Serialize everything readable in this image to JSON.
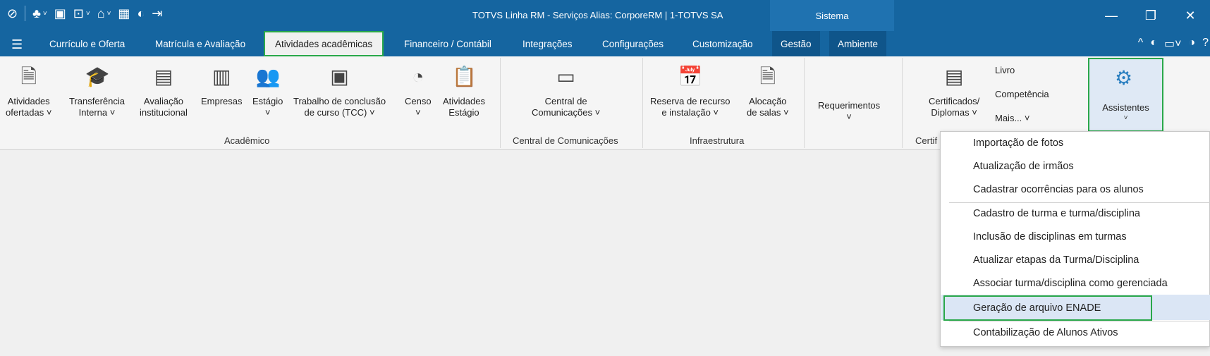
{
  "window": {
    "title": "TOTVS Linha RM - Serviços  Alias: CorporeRM | 1-TOTVS SA",
    "sistema_label": "Sistema",
    "controls": [
      "—",
      "❐",
      "✕"
    ]
  },
  "tabs": [
    {
      "label": "Currículo e Oferta"
    },
    {
      "label": "Matrícula e Avaliação"
    },
    {
      "label": "Atividades acadêmicas"
    },
    {
      "label": "Financeiro / Contábil"
    },
    {
      "label": "Integrações"
    },
    {
      "label": "Configurações"
    },
    {
      "label": "Customização"
    },
    {
      "label": "Gestão"
    },
    {
      "label": "Ambiente"
    }
  ],
  "ribbon": {
    "buttons": [
      {
        "line1": "Atividades",
        "line2": "ofertadas ˅"
      },
      {
        "line1": "Transferência",
        "line2": "Interna ˅"
      },
      {
        "line1": "Avaliação",
        "line2": "institucional"
      },
      {
        "line1": "Empresas",
        "line2": ""
      },
      {
        "line1": "Estágio",
        "line2": "˅"
      },
      {
        "line1": "Trabalho de conclusão",
        "line2": "de curso (TCC) ˅"
      },
      {
        "line1": "Censo",
        "line2": "˅"
      },
      {
        "line1": "Atividades",
        "line2": "Estágio"
      },
      {
        "line1": "Central de",
        "line2": "Comunicações ˅"
      },
      {
        "line1": "Reserva de recurso",
        "line2": "e instalação ˅"
      },
      {
        "line1": "Alocação",
        "line2": "de salas ˅"
      },
      {
        "line1": "Requerimentos",
        "line2": "˅"
      },
      {
        "line1": "Certificados/",
        "line2": "Diplomas ˅"
      }
    ],
    "small": {
      "livro": "Livro",
      "competencia": "Competência",
      "mais": "Mais...  ˅"
    },
    "assistentes": "Assistentes",
    "groups": {
      "academico": "Acadêmico",
      "central": "Central de Comunicações",
      "infra": "Infraestrutura",
      "cert": "Certif"
    }
  },
  "dropdown": {
    "items": [
      "Importação de fotos",
      "Atualização de irmãos",
      "Cadastrar ocorrências para os alunos",
      "Cadastro de turma e turma/disciplina",
      "Inclusão de disciplinas em turmas",
      "Atualizar etapas da Turma/Disciplina",
      "Associar turma/disciplina como gerenciada",
      "Geração de arquivo ENADE",
      "Contabilização de Alunos Ativos"
    ]
  },
  "colors": {
    "titlebar": "#1565a0",
    "highlight": "#2aa84a",
    "selection": "#dbe6f5"
  }
}
